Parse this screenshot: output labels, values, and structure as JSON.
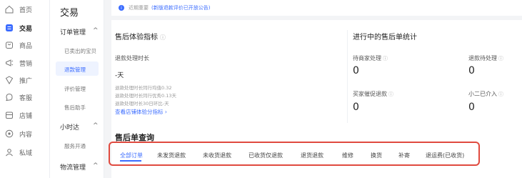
{
  "nav": {
    "items": [
      {
        "label": "首页",
        "icon": "home-icon"
      },
      {
        "label": "交易",
        "icon": "trade-icon",
        "active": true
      },
      {
        "label": "商品",
        "icon": "goods-icon"
      },
      {
        "label": "营销",
        "icon": "marketing-icon"
      },
      {
        "label": "推广",
        "icon": "promotion-icon"
      },
      {
        "label": "客服",
        "icon": "service-icon"
      },
      {
        "label": "店铺",
        "icon": "shop-icon"
      },
      {
        "label": "内容",
        "icon": "content-icon"
      },
      {
        "label": "私域",
        "icon": "private-icon"
      }
    ],
    "accent": "#3b6cff"
  },
  "subnav": {
    "title": "交易",
    "groups": [
      {
        "label": "订单管理",
        "caret": "^"
      },
      {
        "label": "小时达",
        "caret": "^"
      },
      {
        "label": "物流管理",
        "caret": "^"
      }
    ],
    "items": [
      {
        "label": "已卖出的宝贝"
      },
      {
        "label": "退款管理",
        "active": true
      },
      {
        "label": "评价管理"
      },
      {
        "label": "售后助手"
      },
      {
        "label": "服务开通"
      }
    ]
  },
  "notice": {
    "icon": "info-icon",
    "text": "近期重要",
    "link": "(新版退款评价已开放公告)"
  },
  "experience": {
    "title": "售后体验指标",
    "metric_label": "退款处理时长",
    "metric_value": "-天",
    "notes": [
      "退款处理时长同行均值0.32",
      "退款处理时长同行优秀0.13天",
      "退款处理时长30日环比-天"
    ],
    "link": "查看店铺体验分指标 ›"
  },
  "stats": {
    "title": "进行中的售后单统计",
    "cells": [
      {
        "label": "待商家处理",
        "value": "0"
      },
      {
        "label": "退款待处理",
        "value": "0"
      },
      {
        "label": "买家催促退款",
        "value": "0"
      },
      {
        "label": "小二已介入",
        "value": "0"
      }
    ]
  },
  "query": {
    "title": "售后单查询",
    "tabs": [
      "全部订单",
      "未发货退款",
      "未收货退款",
      "已收货仅退款",
      "退货退款",
      "维修",
      "换货",
      "补寄",
      "退运费(已收货)"
    ],
    "active_tab": "全部订单",
    "highlight_color": "#e04a3f"
  }
}
